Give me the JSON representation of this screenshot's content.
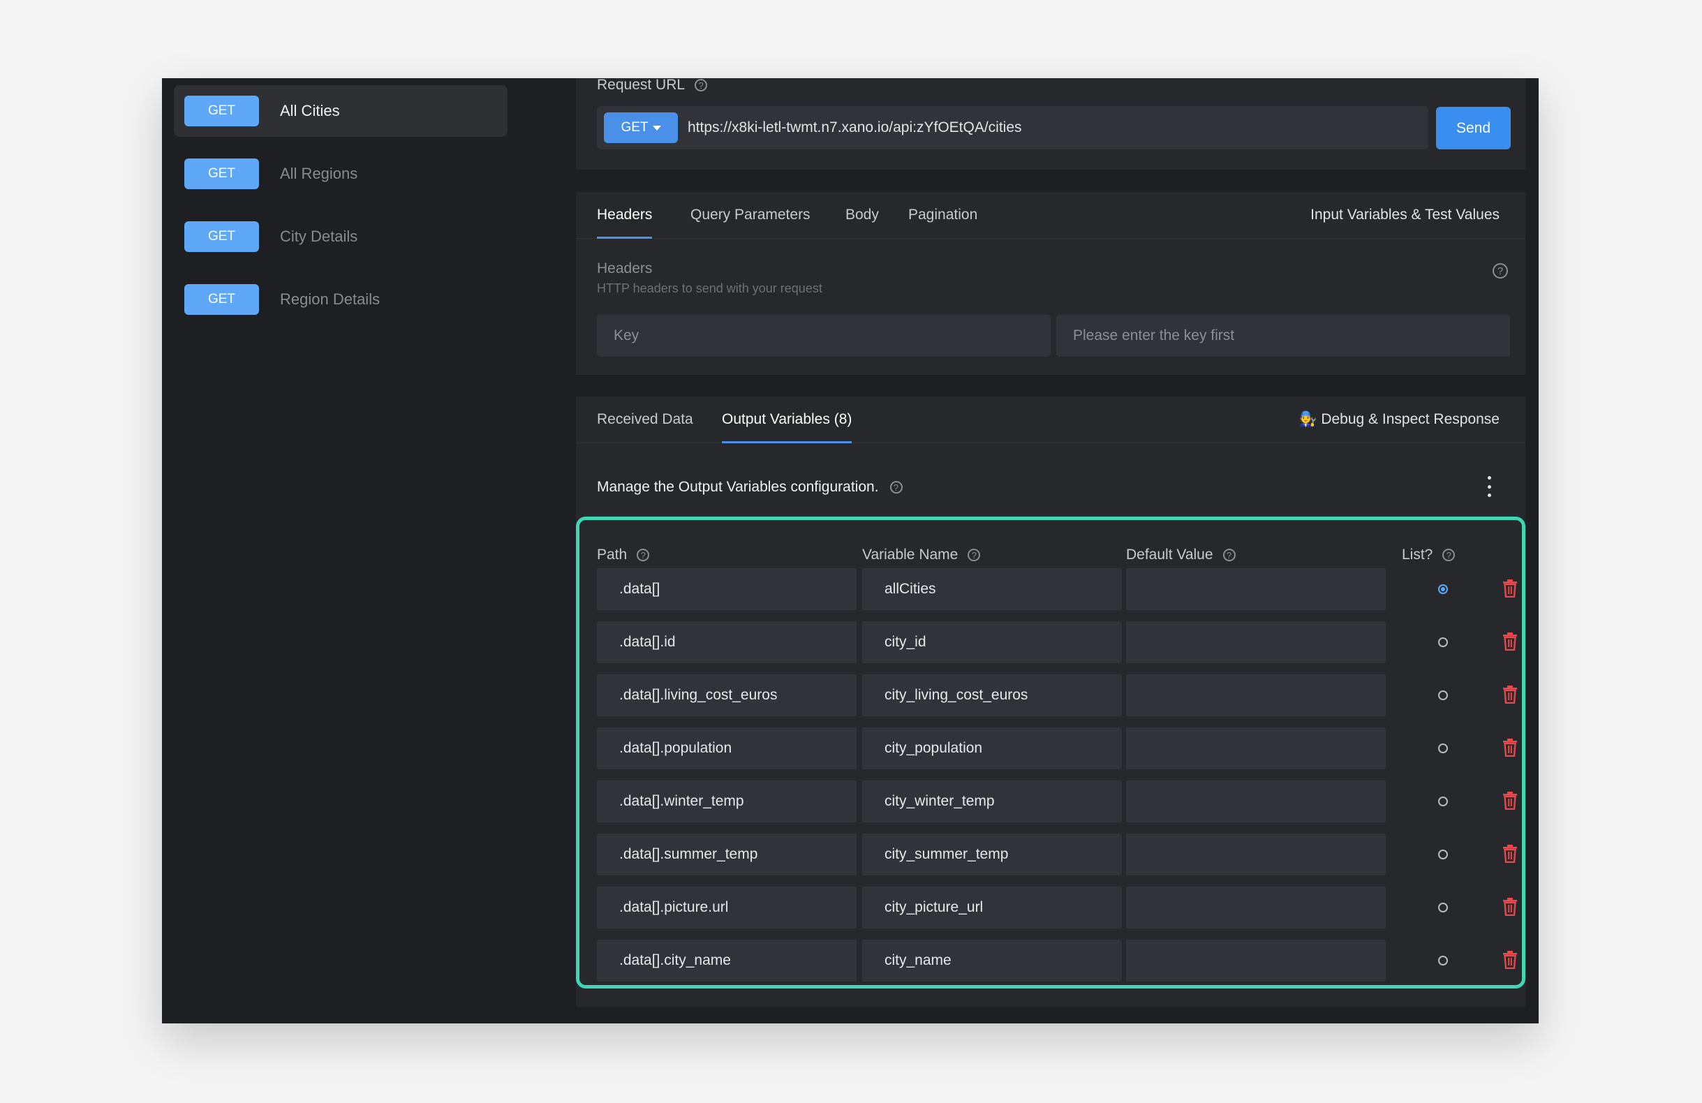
{
  "sidebar": {
    "endpoints": [
      {
        "method": "GET",
        "label": "All Cities",
        "active": true
      },
      {
        "method": "GET",
        "label": "All Regions"
      },
      {
        "method": "GET",
        "label": "City Details"
      },
      {
        "method": "GET",
        "label": "Region Details"
      }
    ]
  },
  "request": {
    "label": "Request URL",
    "method": "GET",
    "url": "https://x8ki-letl-twmt.n7.xano.io/api:zYfOEtQA/cities",
    "send_label": "Send"
  },
  "config_tabs": {
    "items": [
      "Headers",
      "Query Parameters",
      "Body",
      "Pagination"
    ],
    "active": "Headers",
    "right_label": "Input Variables & Test Values"
  },
  "headers": {
    "title": "Headers",
    "subtitle": "HTTP headers to send with your request",
    "key_placeholder": "Key",
    "value_placeholder": "Please enter the key first"
  },
  "response_tabs": {
    "items": [
      "Received Data",
      "Output Variables (8)"
    ],
    "active": "Output Variables (8)",
    "right_label": "🧑‍🔧 Debug & Inspect Response"
  },
  "output": {
    "manage_text": "Manage the Output Variables configuration.",
    "columns": {
      "path": "Path",
      "variable": "Variable Name",
      "default": "Default Value",
      "list": "List?"
    },
    "rows": [
      {
        "path": ".data[]",
        "variable": "allCities",
        "default": "",
        "list": true
      },
      {
        "path": ".data[].id",
        "variable": "city_id",
        "default": "",
        "list": false
      },
      {
        "path": ".data[].living_cost_euros",
        "variable": "city_living_cost_euros",
        "default": "",
        "list": false
      },
      {
        "path": ".data[].population",
        "variable": "city_population",
        "default": "",
        "list": false
      },
      {
        "path": ".data[].winter_temp",
        "variable": "city_winter_temp",
        "default": "",
        "list": false
      },
      {
        "path": ".data[].summer_temp",
        "variable": "city_summer_temp",
        "default": "",
        "list": false
      },
      {
        "path": ".data[].picture.url",
        "variable": "city_picture_url",
        "default": "",
        "list": false
      },
      {
        "path": ".data[].city_name",
        "variable": "city_name",
        "default": "",
        "list": false
      }
    ]
  },
  "colors": {
    "accent": "#4a90e8",
    "highlight": "#3fd6b3",
    "danger": "#e5484d"
  }
}
